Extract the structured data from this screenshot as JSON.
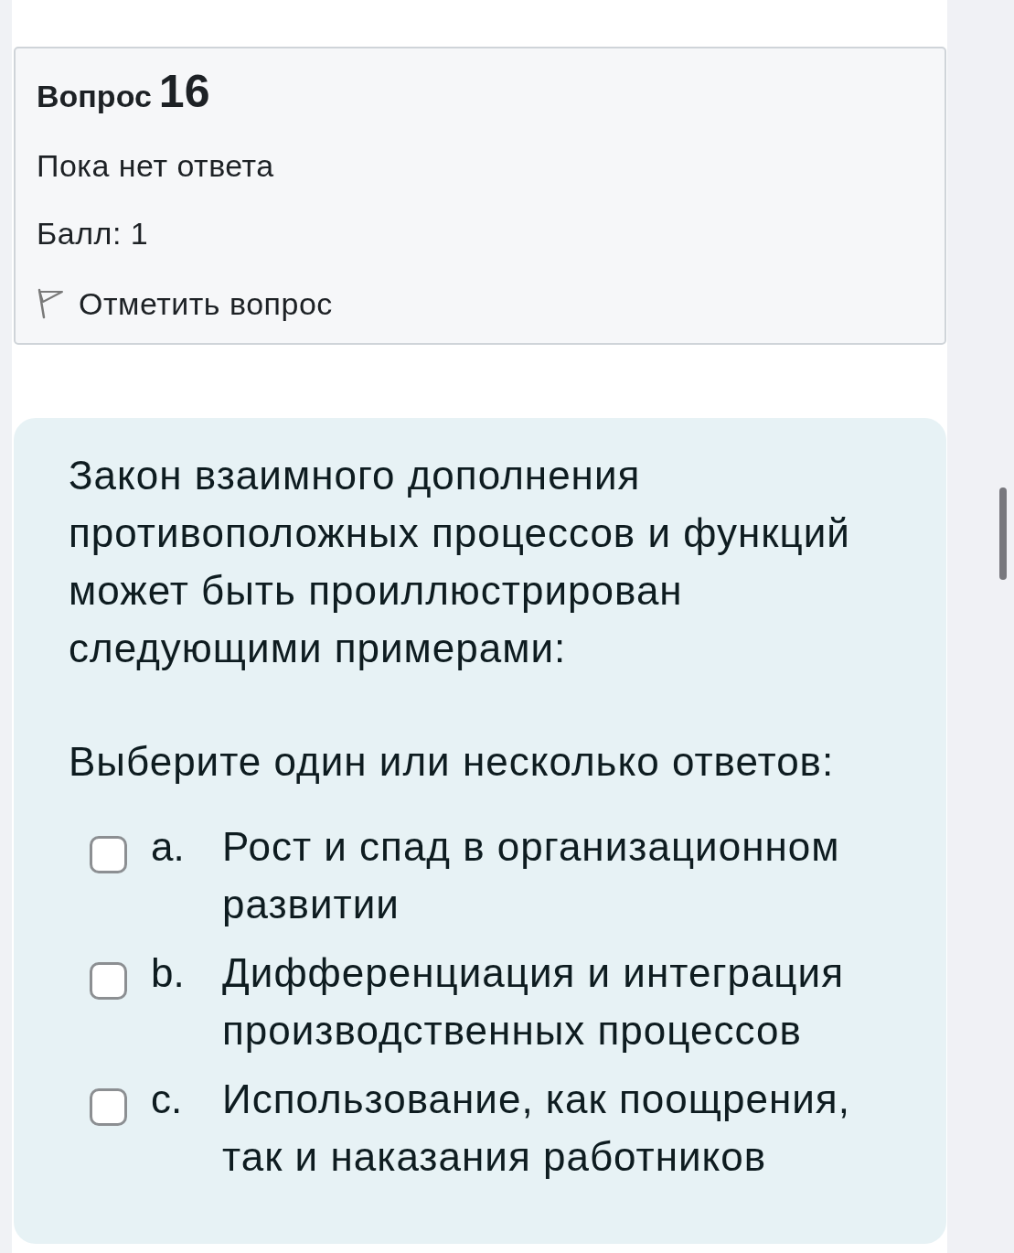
{
  "question_info": {
    "label": "Вопрос",
    "number": "16",
    "status": "Пока нет ответа",
    "mark": "Балл: 1",
    "flag": {
      "label": "Отметить вопрос",
      "flagged": false
    }
  },
  "question": {
    "text": "Закон взаимного дополнения противоположных процессов и функций может быть проиллюстрирован следующими примерами:",
    "prompt": "Выберите один или несколько ответов:",
    "options": [
      {
        "letter": "a.",
        "text": "Рост и спад в организационном развитии",
        "checked": false
      },
      {
        "letter": "b.",
        "text": "Дифференциация и интеграция производственных процессов",
        "checked": false
      },
      {
        "letter": "c.",
        "text": "Использование, как поощрения, так и наказания работников",
        "checked": false
      }
    ]
  }
}
